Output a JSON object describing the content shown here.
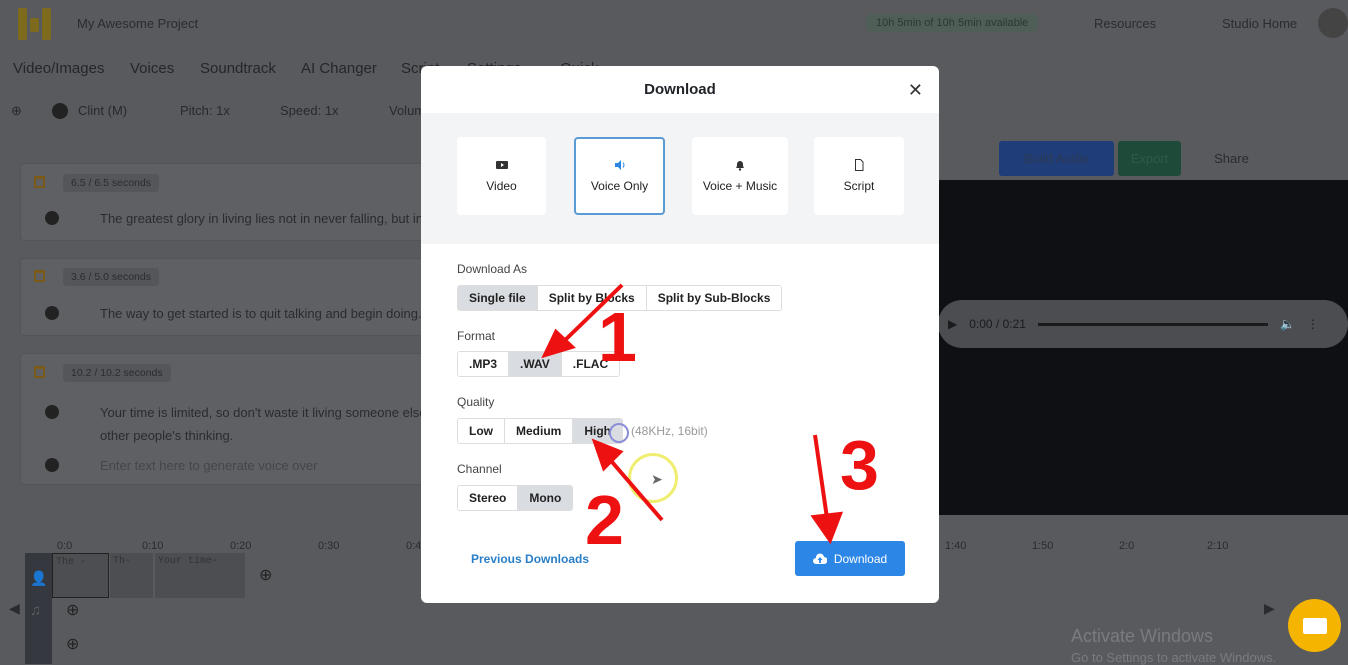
{
  "app": {
    "project_title": "My Awesome Project",
    "availability": "10h 5min of 10h 5min available",
    "resources": "Resources",
    "studio_home": "Studio Home"
  },
  "nav": [
    "Video/Images",
    "Voices",
    "Soundtrack",
    "AI Changer",
    "Script",
    "Settings",
    "Quick"
  ],
  "toolbar": {
    "voice": "Clint (M)",
    "pitch": "Pitch: 1x",
    "speed": "Speed: 1x",
    "volume": "Volume"
  },
  "blocks": [
    {
      "duration": "6.5 / 6.5 seconds",
      "text": "The greatest glory in living lies not in never falling, but in rising"
    },
    {
      "duration": "3.6 / 5.0 seconds",
      "text": "The way to get started is to quit talking and begin doing."
    },
    {
      "duration": "10.2 / 10.2 seconds",
      "text": "Your time is limited, so don't waste it living someone else's life.",
      "text2": "other people's thinking.",
      "placeholder": "Enter text here to generate voice over"
    }
  ],
  "right_actions": {
    "build": "Build Audio",
    "export": "Export",
    "share": "Share"
  },
  "player": {
    "time": "0:00 / 0:21"
  },
  "timeline": {
    "ticks": [
      "0:0",
      "0:10",
      "0:20",
      "0:30",
      "0:4",
      "1:40",
      "1:50",
      "2:0",
      "2:10"
    ],
    "clips": [
      "The -",
      "Th-",
      "Your time-"
    ]
  },
  "modal": {
    "title": "Download",
    "types": [
      {
        "label": "Video",
        "icon": "video-icon"
      },
      {
        "label": "Voice Only",
        "icon": "speaker-icon",
        "selected": true
      },
      {
        "label": "Voice + Music",
        "icon": "bell-icon"
      },
      {
        "label": "Script",
        "icon": "file-icon"
      }
    ],
    "download_as": {
      "label": "Download As",
      "options": [
        "Single file",
        "Split by Blocks",
        "Split by Sub-Blocks"
      ],
      "selected": "Single file"
    },
    "format": {
      "label": "Format",
      "options": [
        ".MP3",
        ".WAV",
        ".FLAC"
      ],
      "selected": ".WAV"
    },
    "quality": {
      "label": "Quality",
      "options": [
        "Low",
        "Medium",
        "High"
      ],
      "selected": "High",
      "hint": "(48KHz, 16bit)"
    },
    "channel": {
      "label": "Channel",
      "options": [
        "Stereo",
        "Mono"
      ],
      "selected": "Mono"
    },
    "previous": "Previous Downloads",
    "download_button": "Download"
  },
  "annotations": [
    "1",
    "2",
    "3"
  ],
  "watermark": {
    "line1": "Activate Windows",
    "line2": "Go to Settings to activate Windows."
  },
  "colors": {
    "accent": "#2b86e6",
    "selected_border": "#5b9bd5",
    "annotation": "#ee1111",
    "chat": "#f4b400"
  }
}
